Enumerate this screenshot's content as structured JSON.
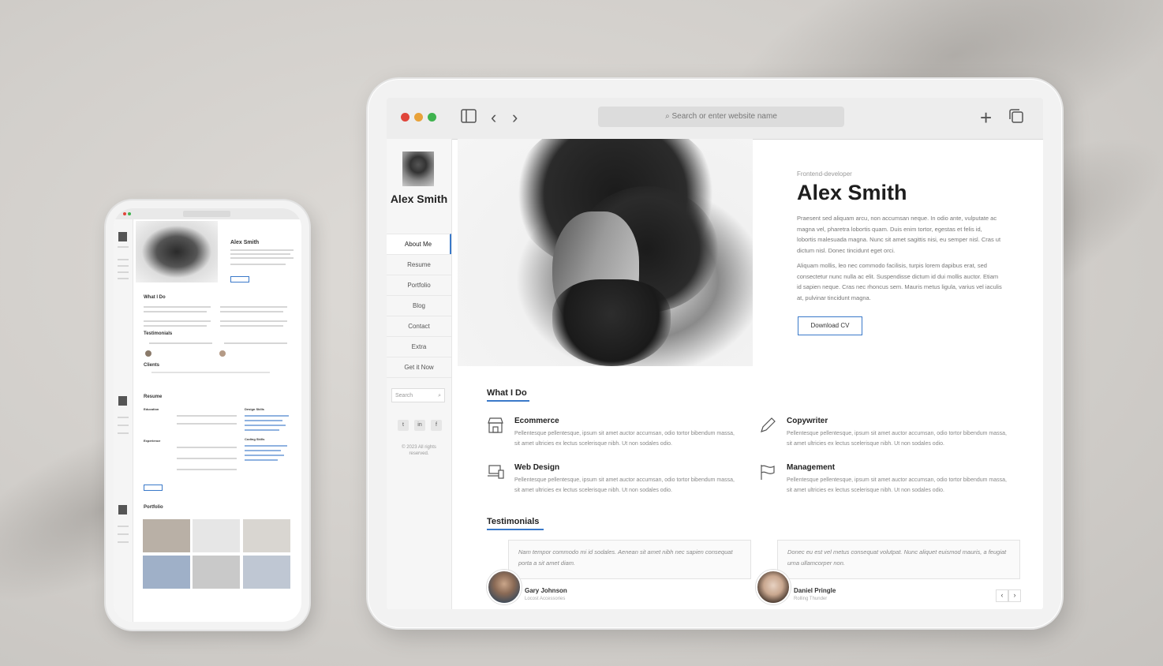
{
  "browser": {
    "url_placeholder": "Search or enter website name",
    "traffic_lights": [
      "#e0453a",
      "#e8a23a",
      "#3fb34f"
    ],
    "accent": "#3a79c9"
  },
  "sidebar": {
    "name": "Alex Smith",
    "nav": [
      "About Me",
      "Resume",
      "Portfolio",
      "Blog",
      "Contact",
      "Extra",
      "Get it Now"
    ],
    "active": "About Me",
    "search_placeholder": "Search",
    "socials": [
      "twitter-icon",
      "linkedin-icon",
      "facebook-icon"
    ],
    "copyright": "© 2023 All rights reserved."
  },
  "hero": {
    "subtitle": "Frontend-developer",
    "title": "Alex Smith",
    "para1": "Praesent sed aliquam arcu, non accumsan neque. In odio ante, vulputate ac magna vel, pharetra lobortis quam. Duis enim tortor, egestas et felis id, lobortis malesuada magna. Nunc sit amet sagittis nisi, eu semper nisl. Cras ut dictum nisl. Donec tincidunt eget orci.",
    "para2": "Aliquam mollis, leo nec commodo facilisis, turpis lorem dapibus erat, sed consectetur nunc nulla ac elit. Suspendisse dictum id dui mollis auctor. Etiam id sapien neque. Cras nec rhoncus sem. Mauris metus ligula, varius vel iaculis at, pulvinar tincidunt magna.",
    "button": "Download CV"
  },
  "what_i_do": {
    "heading": "What I Do",
    "services": [
      {
        "title": "Ecommerce",
        "icon": "store-icon",
        "text": "Pellentesque pellentesque, ipsum sit amet auctor accumsan, odio tortor bibendum massa, sit amet ultricies ex lectus scelerisque nibh. Ut non sodales odio."
      },
      {
        "title": "Copywriter",
        "icon": "pen-icon",
        "text": "Pellentesque pellentesque, ipsum sit amet auctor accumsan, odio tortor bibendum massa, sit amet ultricies ex lectus scelerisque nibh. Ut non sodales odio."
      },
      {
        "title": "Web Design",
        "icon": "devices-icon",
        "text": "Pellentesque pellentesque, ipsum sit amet auctor accumsan, odio tortor bibendum massa, sit amet ultricies ex lectus scelerisque nibh. Ut non sodales odio."
      },
      {
        "title": "Management",
        "icon": "flag-icon",
        "text": "Pellentesque pellentesque, ipsum sit amet auctor accumsan, odio tortor bibendum massa, sit amet ultricies ex lectus scelerisque nibh. Ut non sodales odio."
      }
    ]
  },
  "testimonials": {
    "heading": "Testimonials",
    "items": [
      {
        "quote": "Nam tempor commodo mi id sodales. Aenean sit amet nibh nec sapien consequat porta a sit amet diam.",
        "name": "Gary Johnson",
        "company": "Locost Accessories"
      },
      {
        "quote": "Donec eu est vel metus consequat volutpat. Nunc aliquet euismod mauris, a feugiat urna ullamcorper non.",
        "name": "Daniel Pringle",
        "company": "Rolling Thunder"
      }
    ]
  },
  "phone": {
    "name": "Alex Smith",
    "sections": [
      "What I Do",
      "Testimonials",
      "Clients",
      "Resume",
      "Education",
      "Experience",
      "Design Skills",
      "Coding Skills",
      "Portfolio"
    ],
    "thumb_colors": [
      "#b9b0a6",
      "#e6e6e6",
      "#d9d6d1",
      "#9fb0c8",
      "#c9c9c9",
      "#bfc7d3"
    ]
  }
}
